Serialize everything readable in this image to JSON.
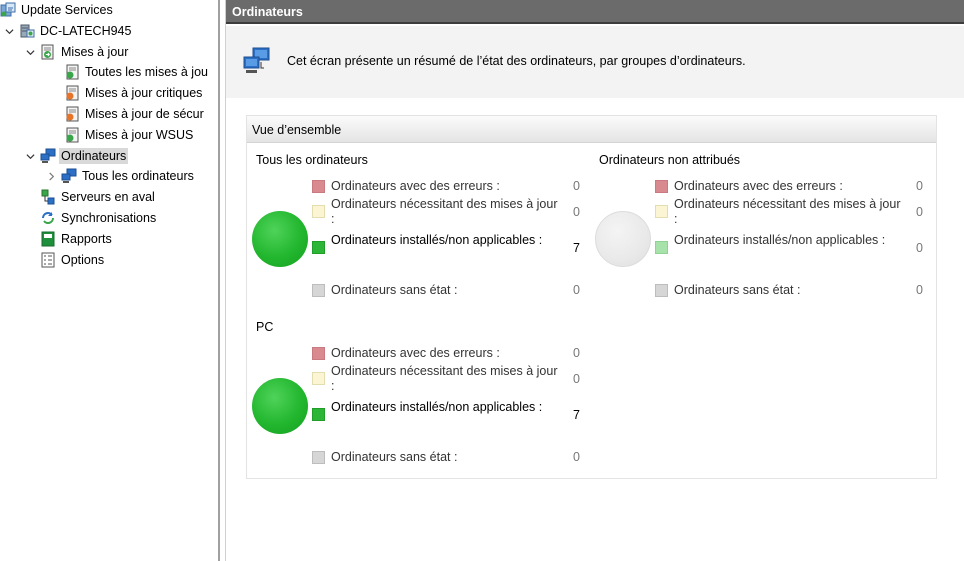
{
  "tree": {
    "nodes": [
      {
        "label": "Update Services",
        "icon": "update-services-icon",
        "chevron": ""
      },
      {
        "label": "DC-LATECH945",
        "icon": "server-icon",
        "chevron": "expanded"
      },
      {
        "label": "Mises à jour",
        "icon": "updates-folder-icon",
        "chevron": "expanded"
      },
      {
        "label": "Toutes les mises à jou",
        "icon": "updates-view-icon",
        "chevron": ""
      },
      {
        "label": "Mises à jour critiques",
        "icon": "updates-view-icon",
        "chevron": ""
      },
      {
        "label": "Mises à jour de sécur",
        "icon": "updates-view-icon",
        "chevron": ""
      },
      {
        "label": "Mises à jour WSUS",
        "icon": "updates-view-icon",
        "chevron": ""
      },
      {
        "label": "Ordinateurs",
        "icon": "computers-icon",
        "chevron": "expanded"
      },
      {
        "label": "Tous les ordinateurs",
        "icon": "computers-icon",
        "chevron": "collapsed"
      },
      {
        "label": "Serveurs en aval",
        "icon": "downstream-servers-icon",
        "chevron": ""
      },
      {
        "label": "Synchronisations",
        "icon": "synchronizations-icon",
        "chevron": ""
      },
      {
        "label": "Rapports",
        "icon": "reports-icon",
        "chevron": ""
      },
      {
        "label": "Options",
        "icon": "options-icon",
        "chevron": ""
      }
    ]
  },
  "header": {
    "title": "Ordinateurs"
  },
  "description": {
    "text": "Cet écran présente un résumé de l’état des ordinateurs, par groupes d’ordinateurs.",
    "icon": "computers-icon"
  },
  "overview": {
    "title": "Vue d’ensemble",
    "groups": [
      {
        "title": "Tous les ordinateurs",
        "status": "green",
        "rows": [
          {
            "label": "Ordinateurs avec des erreurs :",
            "value": "0",
            "color": "#d98a8f"
          },
          {
            "label": "Ordinateurs nécessitant des mises à jour :",
            "value": "0",
            "color": "#fbf5d3"
          },
          {
            "label": "Ordinateurs installés/non applicables :",
            "value": "7",
            "color": "#2cb536"
          },
          {
            "label": "Ordinateurs sans état :",
            "value": "0",
            "color": "#d6d6d6"
          }
        ]
      },
      {
        "title": "Ordinateurs non attribués",
        "status": "grey",
        "rows": [
          {
            "label": "Ordinateurs avec des erreurs :",
            "value": "0",
            "color": "#d98a8f"
          },
          {
            "label": "Ordinateurs nécessitant des mises à jour :",
            "value": "0",
            "color": "#fbf5d3"
          },
          {
            "label": "Ordinateurs installés/non applicables :",
            "value": "0",
            "color": "#a6e2aa"
          },
          {
            "label": "Ordinateurs sans état :",
            "value": "0",
            "color": "#d6d6d6"
          }
        ]
      },
      {
        "title": "PC",
        "status": "green",
        "rows": [
          {
            "label": "Ordinateurs avec des erreurs :",
            "value": "0",
            "color": "#d98a8f"
          },
          {
            "label": "Ordinateurs nécessitant des mises à jour :",
            "value": "0",
            "color": "#fbf5d3"
          },
          {
            "label": "Ordinateurs installés/non applicables :",
            "value": "7",
            "color": "#2cb536"
          },
          {
            "label": "Ordinateurs sans état :",
            "value": "0",
            "color": "#d6d6d6"
          }
        ]
      }
    ]
  },
  "colors": {
    "header_bg": "#6b6b6b",
    "status_green": "#22b62e",
    "status_grey": "#e9e9e9"
  }
}
